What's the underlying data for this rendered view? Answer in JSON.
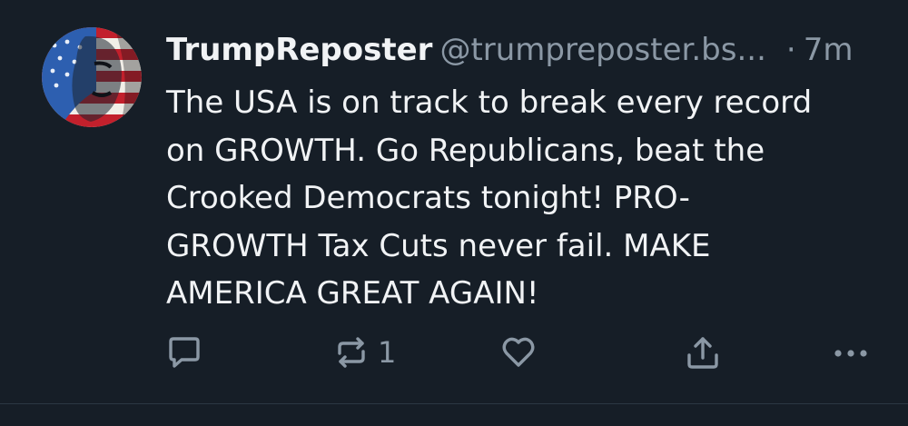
{
  "post": {
    "author": {
      "display_name": "TrumpReposter",
      "handle": "@trumpreposter.bs...",
      "avatar": "avatar-flag-portrait"
    },
    "separator": "·",
    "timestamp": "7m",
    "text": "The USA is on track to break every record\non GROWTH. Go Republicans, beat the\nCrooked Democrats tonight! PRO-\nGROWTH Tax Cuts never fail. MAKE\nAMERICA GREAT AGAIN!"
  },
  "actions": {
    "reply": {
      "icon": "reply-icon",
      "count": ""
    },
    "repost": {
      "icon": "repost-icon",
      "count": "1"
    },
    "like": {
      "icon": "heart-icon",
      "count": ""
    },
    "share": {
      "icon": "share-icon",
      "count": ""
    },
    "more": {
      "icon": "more-icon"
    }
  },
  "colors": {
    "background": "#161e27",
    "text": "#f1f3f5",
    "muted": "#8b98a5",
    "divider": "#2c3743"
  }
}
